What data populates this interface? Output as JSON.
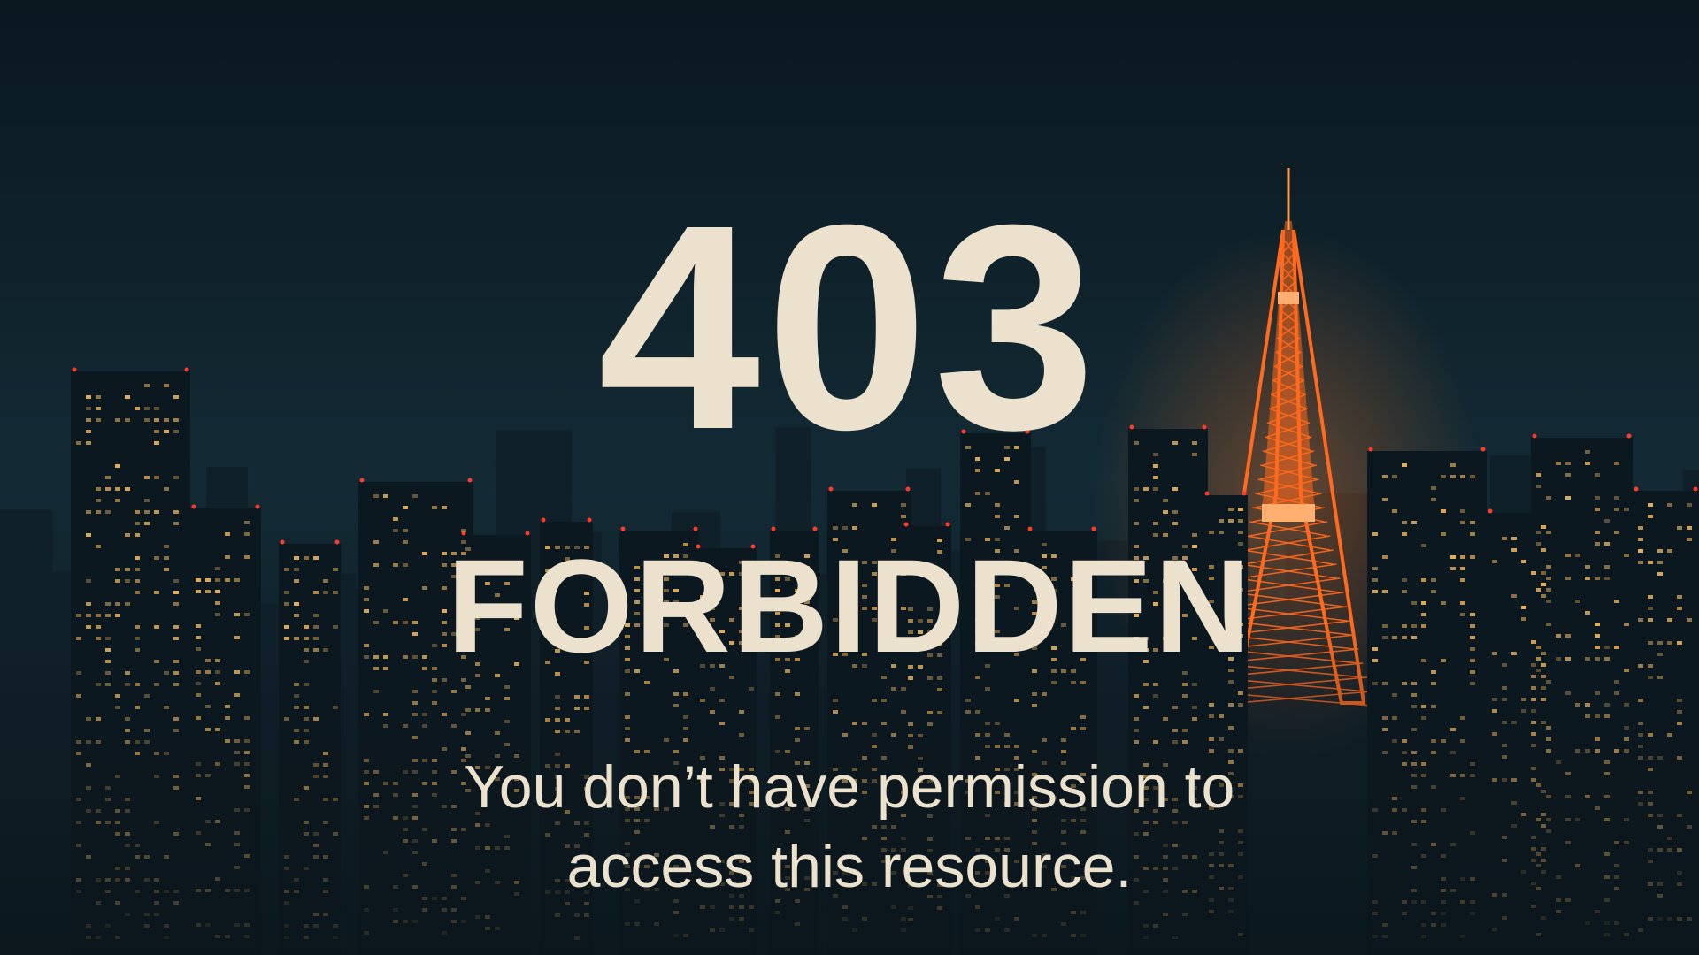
{
  "error": {
    "code": "403",
    "status": "FORBIDDEN",
    "message": "You don’t have permission to access this resource."
  },
  "background": {
    "description_icon": "city-skyline-night",
    "colors": {
      "sky_top": "#0a1820",
      "sky_bottom": "#16303a",
      "buildings": "#0d1a22",
      "window_light": "#f0b860",
      "tower": "#ff6a1e",
      "text": "#ebe1cc"
    }
  }
}
